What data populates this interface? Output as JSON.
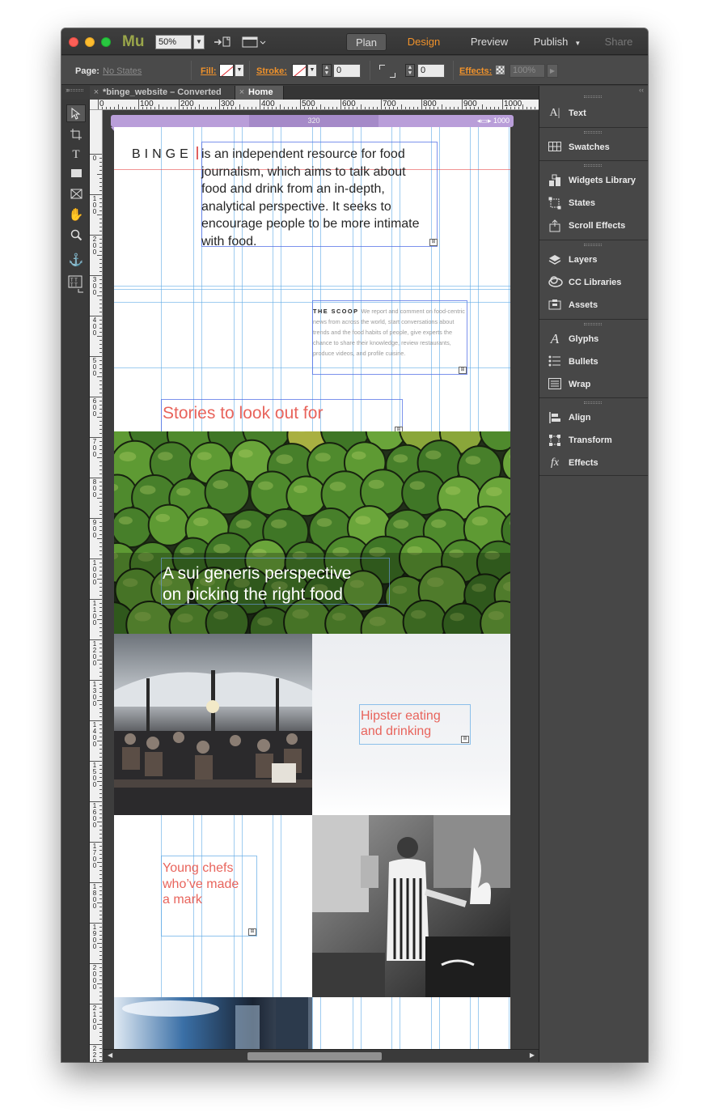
{
  "app": {
    "name": "Mu",
    "zoom": "50%"
  },
  "modes": {
    "plan": "Plan",
    "design": "Design",
    "preview": "Preview",
    "publish": "Publish",
    "share": "Share"
  },
  "controls": {
    "page_label": "Page:",
    "page_state": "No States",
    "fill_label": "Fill:",
    "stroke_label": "Stroke:",
    "stroke_width": "0",
    "corner_radius": "0",
    "effects_label": "Effects:",
    "opacity": "100%"
  },
  "tabs": [
    {
      "label": "*binge_website – Converted"
    },
    {
      "label": "Home"
    }
  ],
  "ruler": {
    "top": [
      "0",
      "100",
      "200",
      "300",
      "400",
      "500",
      "600",
      "700",
      "800",
      "900",
      "1000"
    ],
    "left": [
      "0",
      "100",
      "200",
      "300",
      "400",
      "500",
      "600",
      "700",
      "800",
      "900",
      "1000",
      "1100",
      "1200",
      "1300",
      "1400",
      "1500",
      "1600",
      "1700",
      "1800",
      "1900",
      "2000",
      "2100",
      "2200"
    ]
  },
  "breakpoint": {
    "mid": "320",
    "max": "1000"
  },
  "page": {
    "logo": "BINGE",
    "intro": "is an independent resource for food journalism, which aims to talk about food and drink from an in-depth, analytical perspective. It seeks to encourage people to be more intimate with food.",
    "scoop_title": "THE SCOOP",
    "scoop_text": "We report and comment on food-centric news from across the world, start conversations about trends and the food habits of people, give experts the chance to share their knowledge, review restaurants, produce videos, and profile cuisine.",
    "stories_heading": "Stories to look out for",
    "feature_caption_line1": "A sui generis perspective",
    "feature_caption_line2": "on picking the right food",
    "hipster_line1": "Hipster eating",
    "hipster_line2": "and drinking",
    "young_line1": "Young chefs",
    "young_line2": "who’ve made",
    "young_line3": "a mark"
  },
  "panel": {
    "text": "Text",
    "swatches": "Swatches",
    "widgets": "Widgets Library",
    "states": "States",
    "scroll_effects": "Scroll Effects",
    "layers": "Layers",
    "cc_libraries": "CC Libraries",
    "assets": "Assets",
    "glyphs": "Glyphs",
    "bullets": "Bullets",
    "wrap": "Wrap",
    "align": "Align",
    "transform": "Transform",
    "effects": "Effects"
  },
  "colors": {
    "accent_orange": "#f0922b",
    "heading_coral": "#e8645c",
    "breakpoint_purple": "#b99ed9",
    "guide_blue": "#5faae6"
  }
}
